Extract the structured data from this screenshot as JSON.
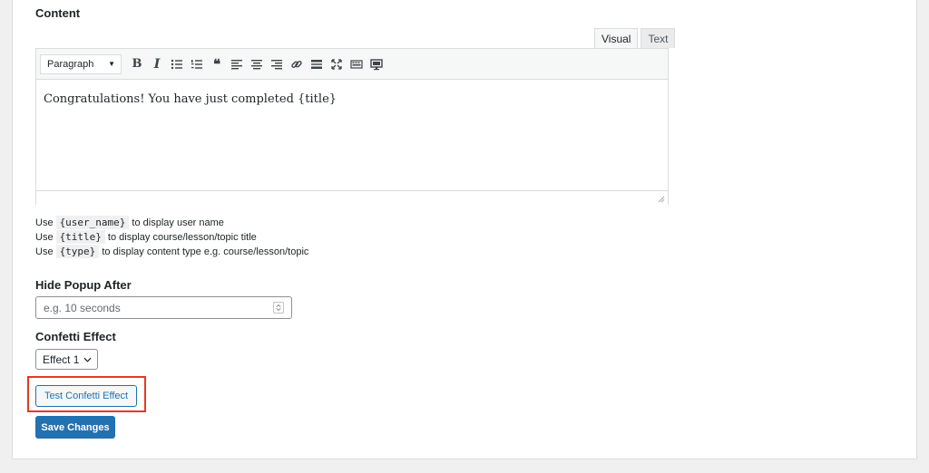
{
  "content": {
    "label": "Content",
    "tabs": {
      "visual": "Visual",
      "text": "Text"
    },
    "format_select": "Paragraph",
    "body": "Congratulations! You have just completed {title}",
    "toolbar_icons": [
      "bold-icon",
      "italic-icon",
      "bulleted-list-icon",
      "numbered-list-icon",
      "blockquote-icon",
      "align-left-icon",
      "align-center-icon",
      "align-right-icon",
      "link-icon",
      "read-more-icon",
      "fullscreen-icon",
      "toolbar-toggle-icon",
      "monitor-icon"
    ]
  },
  "hints": [
    {
      "prefix": "Use",
      "code": "{user_name}",
      "text": "to display user name"
    },
    {
      "prefix": "Use",
      "code": "{title}",
      "text": "to display course/lesson/topic title"
    },
    {
      "prefix": "Use",
      "code": "{type}",
      "text": "to display content type e.g. course/lesson/topic"
    }
  ],
  "hide_popup": {
    "label": "Hide Popup After",
    "placeholder": "e.g. 10 seconds"
  },
  "confetti": {
    "label": "Confetti Effect",
    "selected": "Effect 1"
  },
  "buttons": {
    "test": "Test Confetti Effect",
    "save": "Save Changes"
  },
  "colors": {
    "accent": "#2271b1",
    "highlight": "#e8391f"
  }
}
